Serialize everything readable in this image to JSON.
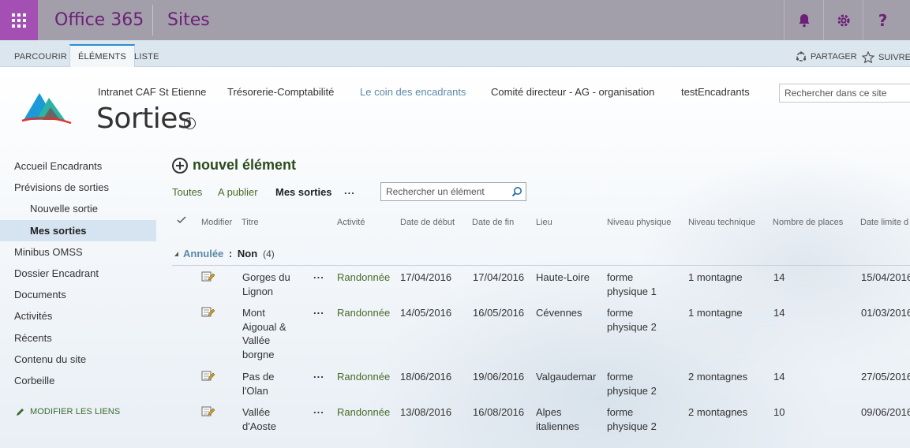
{
  "suite": {
    "brand": "Office 365",
    "app": "Sites"
  },
  "ribbon": {
    "tabs": [
      "PARCOURIR",
      "ÉLÉMENTS",
      "LISTE"
    ],
    "share": "PARTAGER",
    "follow": "SUIVRE"
  },
  "topnav": [
    "Intranet CAF St Etienne",
    "Trésorerie-Comptabilité",
    "Le coin des encadrants",
    "Comité directeur - AG - organisation",
    "testEncadrants"
  ],
  "site_search_placeholder": "Rechercher dans ce site",
  "page_title": "Sorties",
  "leftnav": {
    "items": [
      {
        "label": "Accueil Encadrants"
      },
      {
        "label": "Prévisions de sorties"
      },
      {
        "label": "Nouvelle sortie"
      },
      {
        "label": "Mes sorties"
      },
      {
        "label": "Minibus OMSS"
      },
      {
        "label": "Dossier Encadrant"
      },
      {
        "label": "Documents"
      },
      {
        "label": "Activités"
      },
      {
        "label": "Récents"
      },
      {
        "label": "Contenu du site"
      },
      {
        "label": "Corbeille"
      }
    ],
    "modify_links": "MODIFIER LES LIENS"
  },
  "main": {
    "new_item": "nouvel élément",
    "views": [
      "Toutes",
      "A publier",
      "Mes sorties",
      "..."
    ],
    "list_search_placeholder": "Rechercher un élément",
    "columns": [
      "Modifier",
      "Titre",
      "Activité",
      "Date de début",
      "Date de fin",
      "Lieu",
      "Niveau physique",
      "Niveau technique",
      "Nombre de places",
      "Date limite d"
    ],
    "group": {
      "key": "Annulée",
      "sep": " : ",
      "value": "Non",
      "count": "(4)"
    },
    "rows": [
      {
        "title": "Gorges du Lignon",
        "activity": "Randonnée",
        "start": "17/04/2016",
        "end": "17/04/2016",
        "place": "Haute-Loire",
        "physical": "forme physique 1",
        "technical": "1 montagne",
        "places": "14",
        "deadline": "15/04/2016"
      },
      {
        "title": "Mont Aigoual & Vallée borgne",
        "activity": "Randonnée",
        "start": "14/05/2016",
        "end": "16/05/2016",
        "place": "Cévennes",
        "physical": "forme physique 2",
        "technical": "1 montagne",
        "places": "14",
        "deadline": "01/03/2016"
      },
      {
        "title": "Pas de l'Olan",
        "activity": "Randonnée",
        "start": "18/06/2016",
        "end": "19/06/2016",
        "place": "Valgaudemar",
        "physical": "forme physique 2",
        "technical": "2 montagnes",
        "places": "14",
        "deadline": "27/05/2016"
      },
      {
        "title": "Vallée d'Aoste",
        "activity": "Randonnée",
        "start": "13/08/2016",
        "end": "16/08/2016",
        "place": "Alpes italiennes",
        "physical": "forme physique 2",
        "technical": "2 montagnes",
        "places": "10",
        "deadline": "09/06/2016"
      }
    ]
  },
  "colors": {
    "suite_bg": "#a29fab",
    "waffle_bg": "#a34fb4",
    "brand": "#6d2077",
    "accent_green": "#4a6b2a",
    "selected_nav": "#d5e4f0"
  }
}
